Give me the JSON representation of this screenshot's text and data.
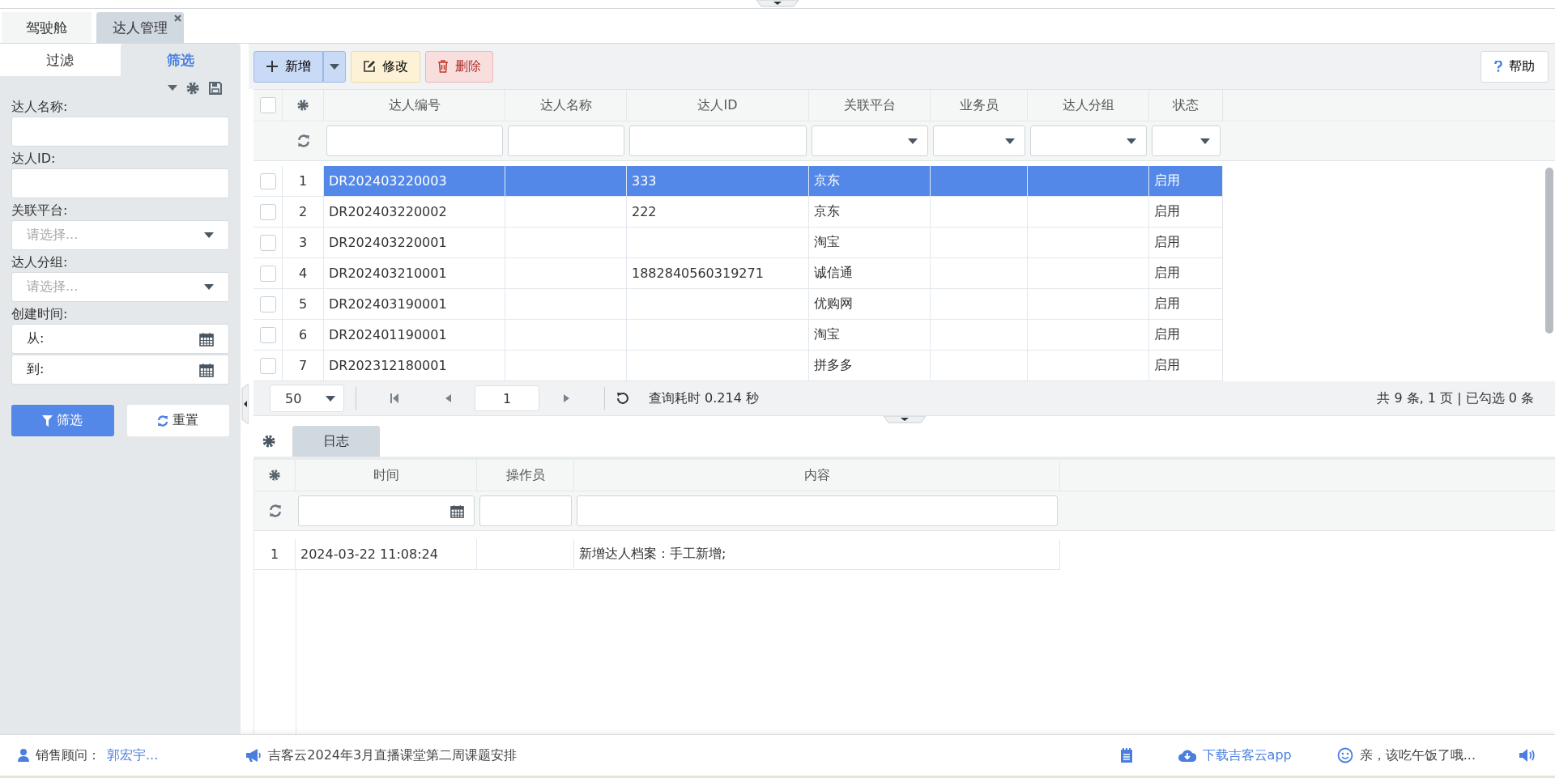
{
  "top_tabs": [
    {
      "label": "驾驶舱",
      "selected": false,
      "closable": false
    },
    {
      "label": "达人管理",
      "selected": true,
      "closable": true
    }
  ],
  "filter_panel": {
    "tabs": [
      {
        "label": "过滤",
        "selected": false
      },
      {
        "label": "筛选",
        "selected": true
      }
    ],
    "fields": [
      {
        "kind": "text",
        "label": "达人名称:"
      },
      {
        "kind": "text",
        "label": "达人ID:"
      },
      {
        "kind": "select",
        "label": "关联平台:",
        "placeholder": "请选择..."
      },
      {
        "kind": "select",
        "label": "达人分组:",
        "placeholder": "请选择..."
      },
      {
        "kind": "daterange",
        "label": "创建时间:",
        "from": "从:",
        "to": "到:"
      }
    ],
    "buttons": [
      {
        "kind": "filter",
        "label": "筛选"
      },
      {
        "kind": "reset",
        "label": "重置"
      }
    ]
  },
  "toolbar": {
    "buttons": [
      {
        "kind": "add",
        "label": "新增"
      },
      {
        "kind": "edit",
        "label": "修改"
      },
      {
        "kind": "delete",
        "label": "删除"
      }
    ],
    "help": "帮助"
  },
  "table": {
    "all_checked": false,
    "columns": [
      {
        "label": "达人编号",
        "kind": "text"
      },
      {
        "label": "达人名称",
        "kind": "text"
      },
      {
        "label": "达人ID",
        "kind": "text"
      },
      {
        "label": "关联平台",
        "kind": "select"
      },
      {
        "label": "业务员",
        "kind": "select"
      },
      {
        "label": "达人分组",
        "kind": "select"
      },
      {
        "label": "状态",
        "kind": "select"
      }
    ],
    "rows": [
      {
        "index": "1",
        "selected": true,
        "checked": false,
        "cells": [
          "DR202403220003",
          null,
          "333",
          "京东",
          null,
          null,
          "启用"
        ]
      },
      {
        "index": "2",
        "selected": false,
        "checked": false,
        "cells": [
          "DR202403220002",
          null,
          "222",
          "京东",
          null,
          null,
          "启用"
        ]
      },
      {
        "index": "3",
        "selected": false,
        "checked": false,
        "cells": [
          "DR202403220001",
          null,
          null,
          "淘宝",
          null,
          null,
          "启用"
        ]
      },
      {
        "index": "4",
        "selected": false,
        "checked": false,
        "cells": [
          "DR202403210001",
          null,
          "1882840560319271",
          "诚信通",
          null,
          null,
          "启用"
        ]
      },
      {
        "index": "5",
        "selected": false,
        "checked": false,
        "cells": [
          "DR202403190001",
          null,
          null,
          "优购网",
          null,
          null,
          "启用"
        ]
      },
      {
        "index": "6",
        "selected": false,
        "checked": false,
        "cells": [
          "DR202401190001",
          null,
          null,
          "淘宝",
          null,
          null,
          "启用"
        ]
      },
      {
        "index": "7",
        "selected": false,
        "checked": false,
        "cells": [
          "DR202312180001",
          null,
          null,
          "拼多多",
          null,
          null,
          "启用"
        ]
      }
    ]
  },
  "pager": {
    "page_size": "50",
    "page": "1",
    "elapsed": "查询耗时 0.214 秒",
    "summary": "共 9 条, 1 页 | 已勾选 0 条"
  },
  "log": {
    "tabs": [
      {
        "label": "日志",
        "selected": true
      }
    ],
    "columns": [
      {
        "label": "时间",
        "kind": "date"
      },
      {
        "label": "操作员",
        "kind": "text"
      },
      {
        "label": "内容",
        "kind": "text"
      }
    ],
    "rows": [
      {
        "index": "1",
        "cells": [
          "2024-03-22 11:08:24",
          null,
          "新增达人档案：手工新增;"
        ]
      }
    ]
  },
  "status_bar": {
    "advisor_label": "销售顾问：",
    "advisor": "郭宏宇...",
    "notice": "吉客云2024年3月直播课堂第二周课题安排",
    "download": "下载吉客云app",
    "greeting": "亲，该吃午饭了哦..."
  }
}
